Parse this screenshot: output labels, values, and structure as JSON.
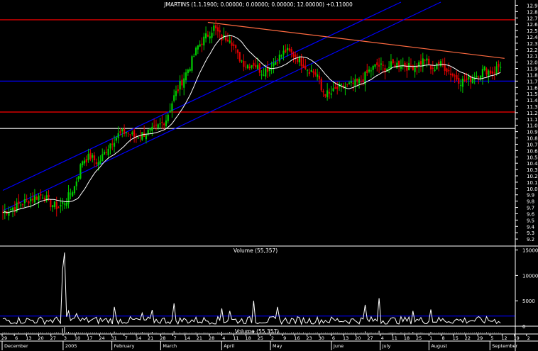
{
  "colors": {
    "background": "#000000",
    "up_candle": "#00cc00",
    "down_candle": "#e00000",
    "moving_average": "#ffffff",
    "channel": "#0000ff",
    "resistance_line": "#ff0000",
    "downtrend_line": "#ff6a40",
    "volume_line": "#ffffff",
    "volume_average": "#0000ff",
    "axis_panel": "#ffffff"
  },
  "chart_data": [
    {
      "type": "candlestick",
      "title": "JMARTINS (1.1.1900; 0.00000; 0.00000; 0.00000; 12.00000) +0.11000",
      "x_axis": {
        "months": [
          "December",
          "2005",
          "February",
          "March",
          "April",
          "May",
          "June",
          "July",
          "August",
          "September"
        ],
        "tick_labels": [
          "29",
          "6",
          "13",
          "20",
          "27",
          "3",
          "10",
          "17",
          "24",
          "31",
          "7",
          "14",
          "21",
          "28",
          "7",
          "14",
          "21",
          "28",
          "4",
          "11",
          "18",
          "25",
          "2",
          "9",
          "16",
          "23",
          "30",
          "6",
          "13",
          "20",
          "27",
          "4",
          "11",
          "18",
          "25",
          "1",
          "8",
          "15",
          "22",
          "29",
          "5",
          "12",
          "19",
          "2"
        ]
      },
      "y_axis": {
        "range": [
          9.1,
          12.95
        ],
        "ticks": [
          9.2,
          9.3,
          9.4,
          9.5,
          9.6,
          9.7,
          9.8,
          9.9,
          10.0,
          10.1,
          10.2,
          10.3,
          10.4,
          10.5,
          10.6,
          10.7,
          10.8,
          10.9,
          11.0,
          11.1,
          11.2,
          11.3,
          11.4,
          11.5,
          11.6,
          11.7,
          11.8,
          11.9,
          12.0,
          12.1,
          12.2,
          12.3,
          12.4,
          12.5,
          12.6,
          12.7,
          12.8,
          12.9
        ]
      },
      "horizontal_lines": [
        {
          "value": 12.67,
          "color": "#ff0000"
        },
        {
          "value": 11.7,
          "color": "#0000ff"
        },
        {
          "value": 11.21,
          "color": "#ff0000"
        },
        {
          "value": 10.95,
          "color": "#ffffff"
        }
      ],
      "trend_lines": [
        {
          "name": "channel-lower",
          "from": {
            "bar": 0,
            "value": 9.65
          },
          "to": {
            "bar": 220,
            "value": 12.95
          },
          "color": "#0000ff"
        },
        {
          "name": "channel-upper",
          "from": {
            "bar": 0,
            "value": 9.97
          },
          "to": {
            "bar": 200,
            "value": 12.95
          },
          "color": "#0000ff"
        },
        {
          "name": "downtrend",
          "from": {
            "bar": 103,
            "value": 12.63
          },
          "to": {
            "bar": 252,
            "value": 12.06
          },
          "color": "#ff6a40"
        }
      ],
      "price_points": [
        [
          0,
          9.62
        ],
        [
          8,
          9.74
        ],
        [
          14,
          9.84
        ],
        [
          20,
          9.9
        ],
        [
          24,
          9.76
        ],
        [
          28,
          9.7
        ],
        [
          32,
          9.82
        ],
        [
          36,
          10.03
        ],
        [
          40,
          10.45
        ],
        [
          44,
          10.5
        ],
        [
          48,
          10.4
        ],
        [
          54,
          10.72
        ],
        [
          58,
          10.85
        ],
        [
          62,
          10.9
        ],
        [
          66,
          10.82
        ],
        [
          70,
          10.86
        ],
        [
          76,
          10.92
        ],
        [
          82,
          11.1
        ],
        [
          86,
          11.45
        ],
        [
          90,
          11.7
        ],
        [
          94,
          11.95
        ],
        [
          98,
          12.25
        ],
        [
          102,
          12.4
        ],
        [
          106,
          12.55
        ],
        [
          110,
          12.38
        ],
        [
          114,
          12.4
        ],
        [
          118,
          12.1
        ],
        [
          122,
          11.95
        ],
        [
          126,
          11.98
        ],
        [
          130,
          11.85
        ],
        [
          134,
          11.92
        ],
        [
          138,
          12.05
        ],
        [
          142,
          12.18
        ],
        [
          146,
          12.12
        ],
        [
          150,
          12.0
        ],
        [
          154,
          11.88
        ],
        [
          158,
          11.8
        ],
        [
          160,
          11.55
        ],
        [
          164,
          11.48
        ],
        [
          168,
          11.58
        ],
        [
          172,
          11.62
        ],
        [
          176,
          11.65
        ],
        [
          180,
          11.7
        ],
        [
          184,
          11.86
        ],
        [
          188,
          11.95
        ],
        [
          192,
          11.9
        ],
        [
          196,
          11.96
        ],
        [
          200,
          11.97
        ],
        [
          204,
          11.92
        ],
        [
          208,
          11.95
        ],
        [
          212,
          12.05
        ],
        [
          216,
          11.85
        ],
        [
          218,
          12.0
        ],
        [
          222,
          11.92
        ],
        [
          226,
          11.8
        ],
        [
          230,
          11.7
        ],
        [
          234,
          11.72
        ],
        [
          238,
          11.8
        ],
        [
          242,
          11.88
        ],
        [
          246,
          11.84
        ],
        [
          250,
          11.96
        ]
      ]
    },
    {
      "type": "line",
      "title": "Volume (55,357)",
      "y_axis": {
        "range": [
          0,
          15500
        ],
        "ticks": [
          0,
          5000,
          10000,
          15000
        ]
      },
      "average_line": 2000,
      "series": [
        {
          "name": "Volume",
          "peaks": [
            [
              30,
              11000
            ],
            [
              31,
              14500
            ],
            [
              33,
              3000
            ],
            [
              37,
              2500
            ],
            [
              56,
              3800
            ],
            [
              70,
              2600
            ],
            [
              75,
              3200
            ],
            [
              86,
              4500
            ],
            [
              110,
              3500
            ],
            [
              114,
              3000
            ],
            [
              126,
              5000
            ],
            [
              138,
              3800
            ],
            [
              182,
              4200
            ],
            [
              189,
              5500
            ],
            [
              206,
              3000
            ],
            [
              215,
              3300
            ]
          ]
        }
      ]
    }
  ],
  "volume_panel_caption": "Volume (55,357)"
}
